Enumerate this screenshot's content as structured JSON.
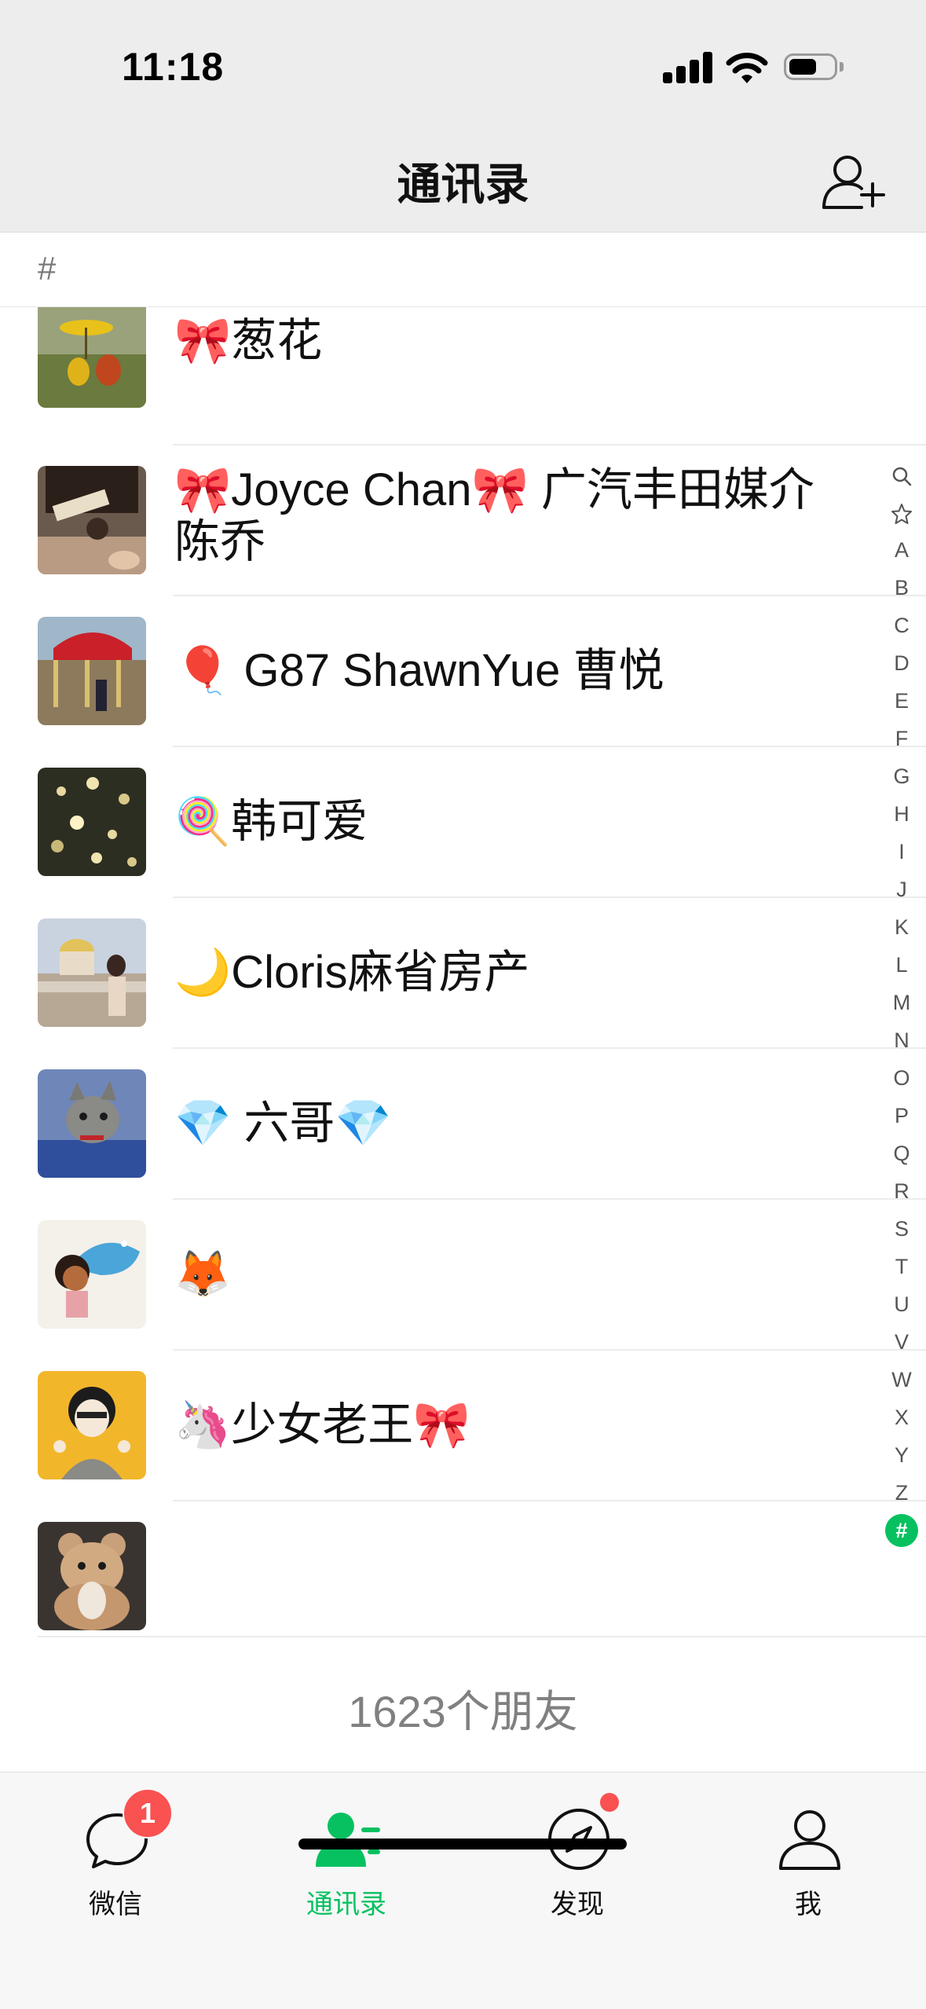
{
  "status_bar": {
    "time": "11:18"
  },
  "nav": {
    "title": "通讯录"
  },
  "section": {
    "letter": "#"
  },
  "contacts": [
    {
      "name": "🎀葱花"
    },
    {
      "name": "🎀Joyce Chan🎀 广汽丰田媒介陈乔"
    },
    {
      "name": "🎈 G87 ShawnYue 曹悦"
    },
    {
      "name": "🍭韩可爱"
    },
    {
      "name": "🌙Cloris麻省房产"
    },
    {
      "name": "💎 六哥💎"
    },
    {
      "name": "🦊"
    },
    {
      "name": "🦄少女老王🎀"
    },
    {
      "name": ""
    }
  ],
  "index_bar": [
    "search",
    "star",
    "A",
    "B",
    "C",
    "D",
    "E",
    "F",
    "G",
    "H",
    "I",
    "J",
    "K",
    "L",
    "M",
    "N",
    "O",
    "P",
    "Q",
    "R",
    "S",
    "T",
    "U",
    "V",
    "W",
    "X",
    "Y",
    "Z",
    "#"
  ],
  "footer": {
    "friend_count": "1623个朋友"
  },
  "tabs": [
    {
      "label": "微信",
      "icon": "chat-bubble-icon",
      "badge": "1"
    },
    {
      "label": "通讯录",
      "icon": "contacts-icon",
      "active": true
    },
    {
      "label": "发现",
      "icon": "compass-icon",
      "dot": true
    },
    {
      "label": "我",
      "icon": "person-icon"
    }
  ],
  "colors": {
    "accent": "#07c160",
    "badge": "#fa5151"
  }
}
